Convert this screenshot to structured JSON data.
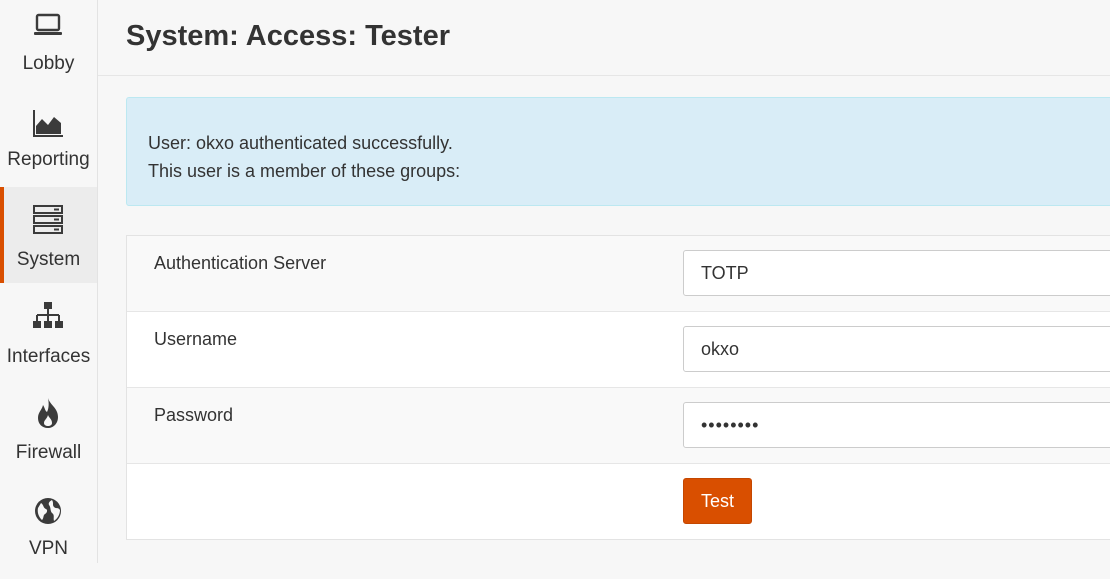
{
  "sidebar": {
    "items": [
      {
        "label": "Lobby",
        "icon": "laptop-icon"
      },
      {
        "label": "Reporting",
        "icon": "area-chart-icon"
      },
      {
        "label": "System",
        "icon": "server-icon",
        "active": true
      },
      {
        "label": "Interfaces",
        "icon": "sitemap-icon"
      },
      {
        "label": "Firewall",
        "icon": "fire-icon"
      },
      {
        "label": "VPN",
        "icon": "globe-icon"
      }
    ]
  },
  "header": {
    "title": "System: Access: Tester"
  },
  "alert": {
    "line1": "User: okxo authenticated successfully.",
    "line2": "This user is a member of these groups:"
  },
  "form": {
    "server_label": "Authentication Server",
    "server_value": "TOTP",
    "username_label": "Username",
    "username_value": "okxo",
    "password_label": "Password",
    "password_value": "••••••••",
    "test_label": "Test"
  },
  "colors": {
    "accent": "#d94f00",
    "alert_bg": "#d9edf7",
    "icon": "#3b3b3b"
  }
}
